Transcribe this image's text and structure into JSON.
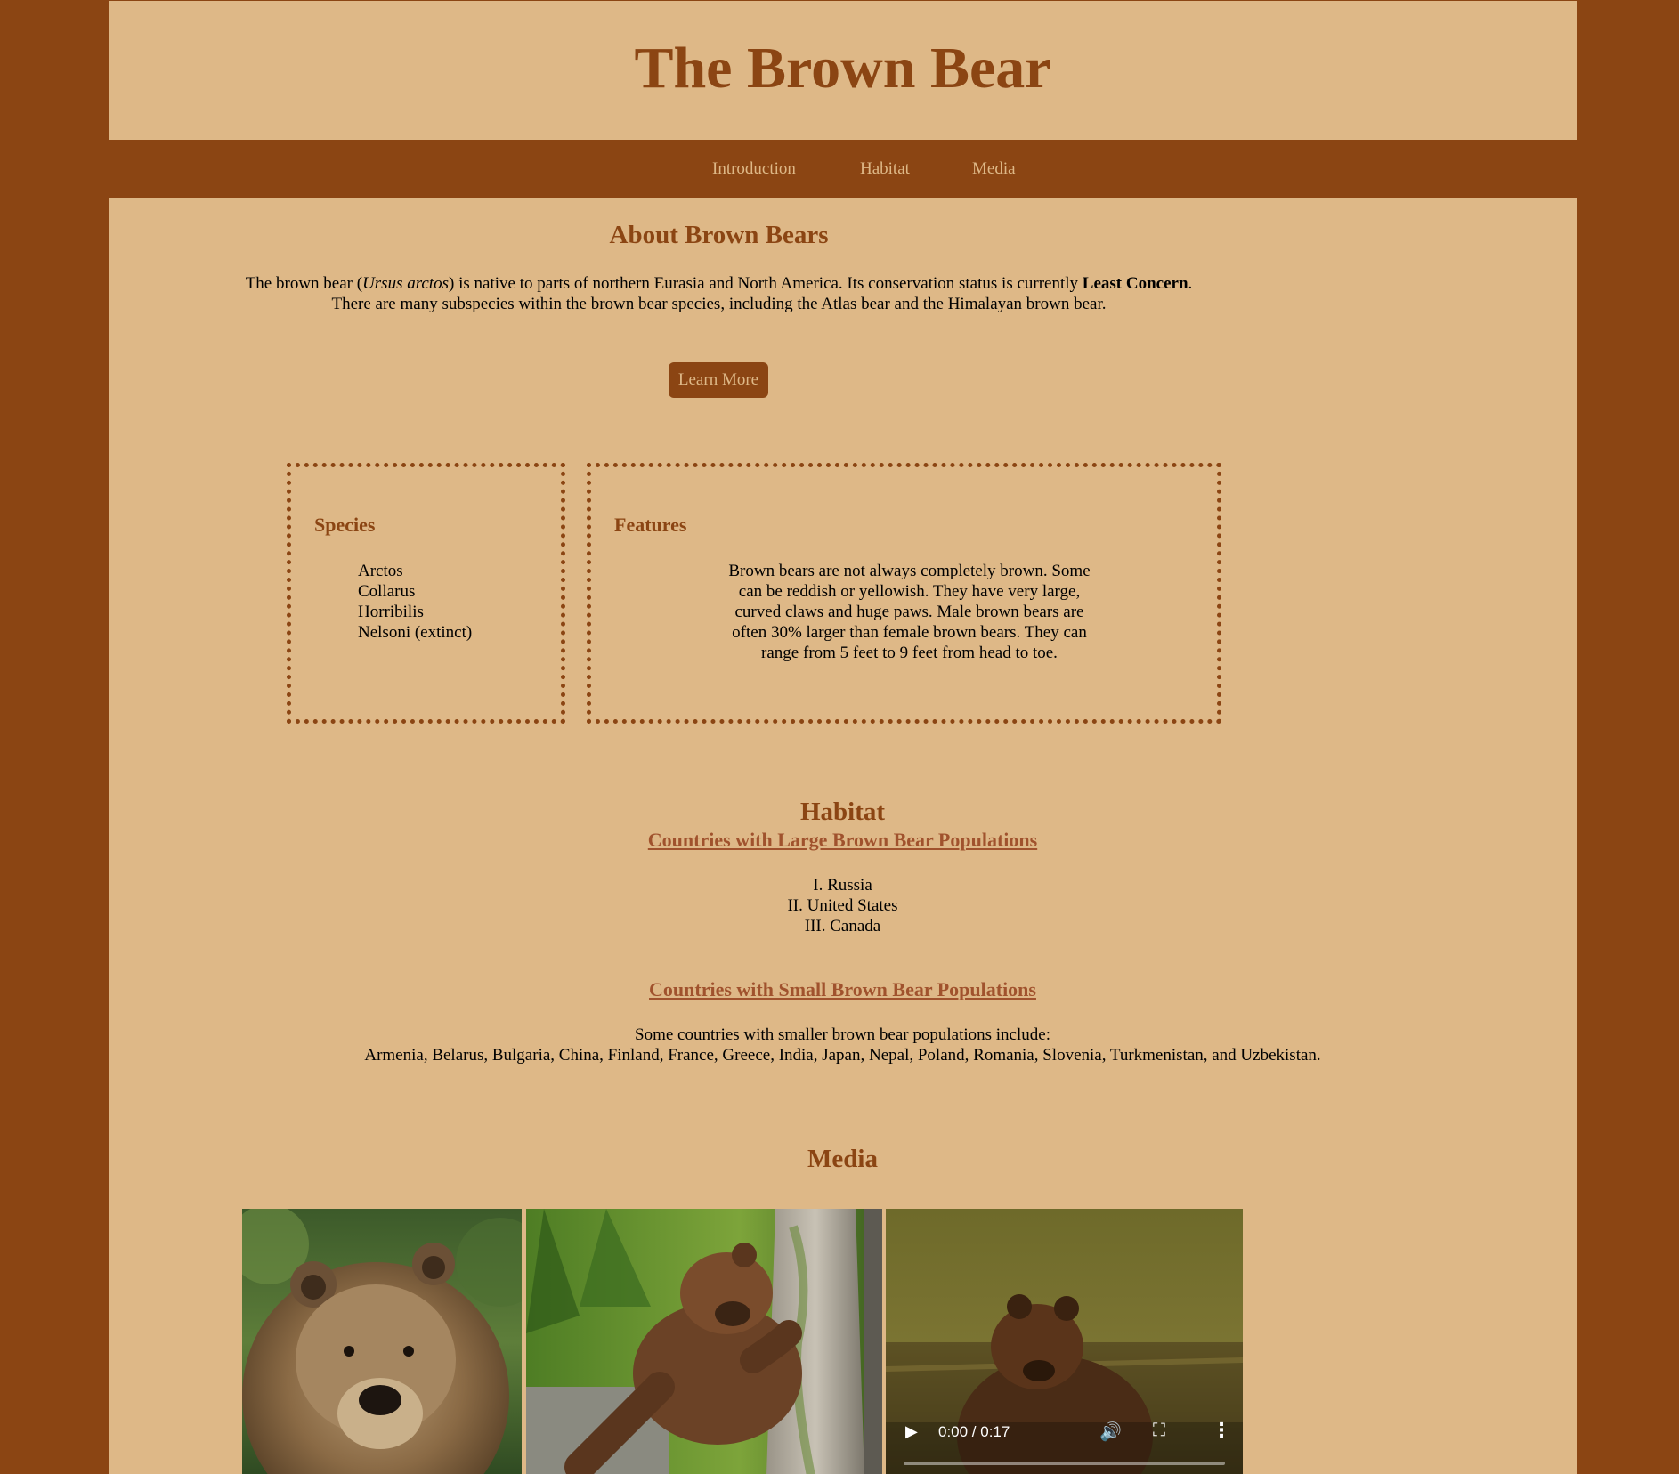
{
  "header": {
    "title": "The Brown Bear"
  },
  "nav": {
    "items": [
      "Introduction",
      "Habitat",
      "Media"
    ]
  },
  "about": {
    "title": "About Brown Bears",
    "line1_pre": "The brown bear (",
    "line1_italic": "Ursus arctos",
    "line1_mid": ") is native to parts of northern Eurasia and North America. Its conservation status is currently ",
    "line1_bold": "Least Concern",
    "line1_post": ".",
    "line2": "There are many subspecies within the brown bear species, including the Atlas bear and the Himalayan brown bear.",
    "button": "Learn More"
  },
  "species": {
    "title": "Species",
    "items": [
      "Arctos",
      "Collarus",
      "Horribilis",
      "Nelsoni (extinct)"
    ]
  },
  "features": {
    "title": "Features",
    "text": "Brown bears are not always completely brown. Some can be reddish or yellowish. They have very large, curved claws and huge paws. Male brown bears are often 30% larger than female brown bears. They can range from 5 feet to 9 feet from head to toe."
  },
  "habitat": {
    "title": "Habitat",
    "large_heading": "Countries with Large Brown Bear Populations",
    "large_list": [
      "I. Russia",
      "II. United States",
      "III. Canada"
    ],
    "small_heading": "Countries with Small Brown Bear Populations",
    "small_intro": "Some countries with smaller brown bear populations include:",
    "small_list": "Armenia, Belarus, Bulgaria, China, Finland, France, Greece, India, Japan, Nepal, Poland, Romania, Slovenia, Turkmenistan, and Uzbekistan."
  },
  "media": {
    "title": "Media",
    "video_time": "0:00 / 0:17",
    "video_progress": 0.0
  },
  "colors": {
    "brown": "#8b4513",
    "tan": "#deb887",
    "link": "#a0522d"
  },
  "icons": [
    "play-icon",
    "volume-icon",
    "fullscreen-icon",
    "more-options-icon"
  ]
}
